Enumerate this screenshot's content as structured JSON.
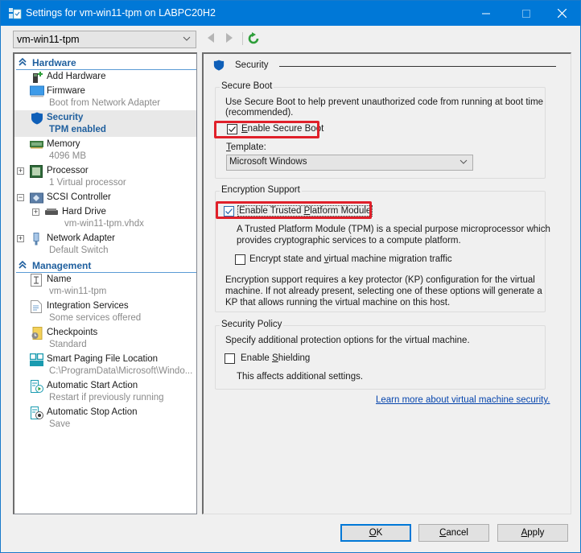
{
  "window": {
    "title": "Settings for vm-win11-tpm on LABPC20H2",
    "controls": {
      "minimize": "minimize",
      "maximize": "maximize",
      "close": "close"
    }
  },
  "toolbar": {
    "vm_selector": {
      "value": "vm-win11-tpm"
    },
    "back_icon": "triangle-left",
    "forward_icon": "triangle-right",
    "refresh_icon": "refresh-arrow"
  },
  "sidebar": {
    "hardware_label": "Hardware",
    "management_label": "Management",
    "hardware_items": [
      {
        "label": "Add Hardware",
        "sub": "",
        "icon": "add-hardware-icon"
      },
      {
        "label": "Firmware",
        "sub": "Boot from Network Adapter",
        "icon": "firmware-icon"
      },
      {
        "label": "Security",
        "sub": "TPM enabled",
        "icon": "shield-icon",
        "selected": true
      },
      {
        "label": "Memory",
        "sub": "4096 MB",
        "icon": "memory-icon"
      },
      {
        "label": "Processor",
        "sub": "1 Virtual processor",
        "icon": "processor-icon",
        "expander": "+"
      },
      {
        "label": "SCSI Controller",
        "sub": "",
        "icon": "scsi-controller-icon",
        "expander": "−"
      },
      {
        "label": "Hard Drive",
        "sub": "vm-win11-tpm.vhdx",
        "icon": "hard-drive-icon",
        "expander": "+"
      },
      {
        "label": "Network Adapter",
        "sub": "Default Switch",
        "icon": "network-adapter-icon",
        "expander": "+"
      }
    ],
    "management_items": [
      {
        "label": "Name",
        "sub": "vm-win11-tpm",
        "icon": "name-icon"
      },
      {
        "label": "Integration Services",
        "sub": "Some services offered",
        "icon": "integration-services-icon"
      },
      {
        "label": "Checkpoints",
        "sub": "Standard",
        "icon": "checkpoints-icon"
      },
      {
        "label": "Smart Paging File Location",
        "sub": "C:\\ProgramData\\Microsoft\\Windo...",
        "icon": "smart-paging-icon"
      },
      {
        "label": "Automatic Start Action",
        "sub": "Restart if previously running",
        "icon": "auto-start-icon"
      },
      {
        "label": "Automatic Stop Action",
        "sub": "Save",
        "icon": "auto-stop-icon"
      }
    ]
  },
  "main": {
    "section_title": "Security",
    "secure_boot": {
      "group_label": "Secure Boot",
      "description_line1": "Use Secure Boot to help prevent unauthorized code from running at boot time",
      "description_line2": "(recommended).",
      "enable_label_accel": "E",
      "enable_label_rest": "nable Secure Boot",
      "enable_checked": true,
      "template_label_accel": "T",
      "template_label_rest": "emplate:",
      "template_value": "Microsoft Windows"
    },
    "encryption": {
      "group_label": "Encryption Support",
      "tpm_label_pre": "Enable Trusted ",
      "tpm_label_accel": "P",
      "tpm_label_post": "latform Module",
      "tpm_checked": true,
      "tpm_desc_line1": "A Trusted Platform Module (TPM) is a special purpose microprocessor which",
      "tpm_desc_line2": "provides cryptographic services to a compute platform.",
      "encrypt_label_pre": "Encrypt state and ",
      "encrypt_label_accel": "v",
      "encrypt_label_post": "irtual machine migration traffic",
      "encrypt_checked": false,
      "kp_line1": "Encryption support requires a key protector (KP) configuration for the virtual",
      "kp_line2": "machine. If not already present, selecting one of these options will generate a",
      "kp_line3": "KP that allows running the virtual machine on this host."
    },
    "policy": {
      "group_label": "Security Policy",
      "description": "Specify additional protection options for the virtual machine.",
      "shield_label_pre": "Enable ",
      "shield_label_accel": "S",
      "shield_label_post": "hielding",
      "shield_checked": false,
      "note": "This affects additional settings."
    },
    "learn_more_link": "Learn more about virtual machine security."
  },
  "footer": {
    "ok_accel": "O",
    "ok_rest": "K",
    "cancel_accel": "C",
    "cancel_rest": "ancel",
    "apply_accel": "A",
    "apply_rest": "pply"
  },
  "colors": {
    "titlebar": "#0078d7",
    "accent_text": "#1f5f9e",
    "highlight_box": "#e0202a",
    "link": "#0645ad"
  }
}
